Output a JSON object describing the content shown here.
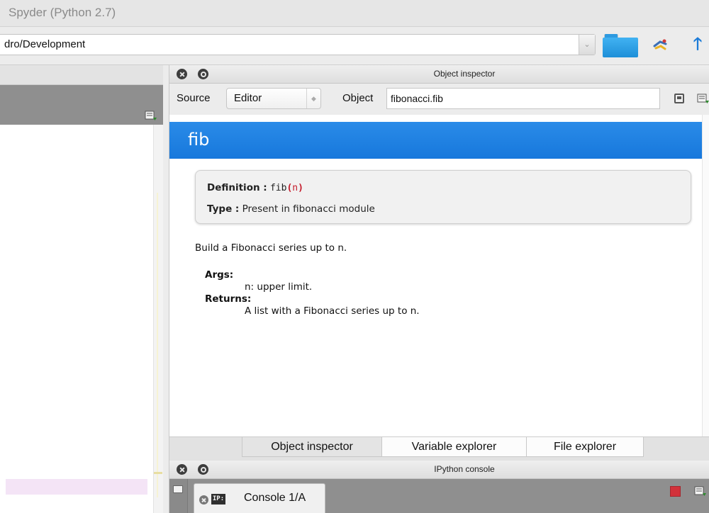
{
  "window": {
    "title": "Spyder (Python 2.7)"
  },
  "toolbar": {
    "path_value": "dro/Development",
    "folder_icon": "folder-icon",
    "python_path_icon": "python-path-icon",
    "up_icon": "arrow-up-icon"
  },
  "object_inspector": {
    "title": "Object inspector",
    "source_label": "Source",
    "source_value": "Editor",
    "object_label": "Object",
    "object_value": "fibonacci.fib",
    "doc": {
      "name": "fib",
      "definition_label": "Definition :",
      "definition_func": "fib",
      "definition_open": "(",
      "definition_arg": "n",
      "definition_close": ")",
      "type_label": "Type :",
      "type_value": "Present in fibonacci module",
      "description": "Build a Fibonacci series up to n.",
      "args_label": "Args:",
      "args_text": "n: upper limit.",
      "returns_label": "Returns:",
      "returns_text": "A list with a Fibonacci series up to n."
    },
    "tabs": [
      {
        "label": "Object inspector",
        "active": true
      },
      {
        "label": "Variable explorer",
        "active": false
      },
      {
        "label": "File explorer",
        "active": false
      }
    ]
  },
  "ipython_console": {
    "title": "IPython console",
    "console_tab_badge": "IP:",
    "console_tab_label": "Console 1/A"
  },
  "colors": {
    "banner": "#1f82e3",
    "folder": "#2d9ae0",
    "stop": "#d2313a",
    "definition_red": "#c41a2a"
  }
}
